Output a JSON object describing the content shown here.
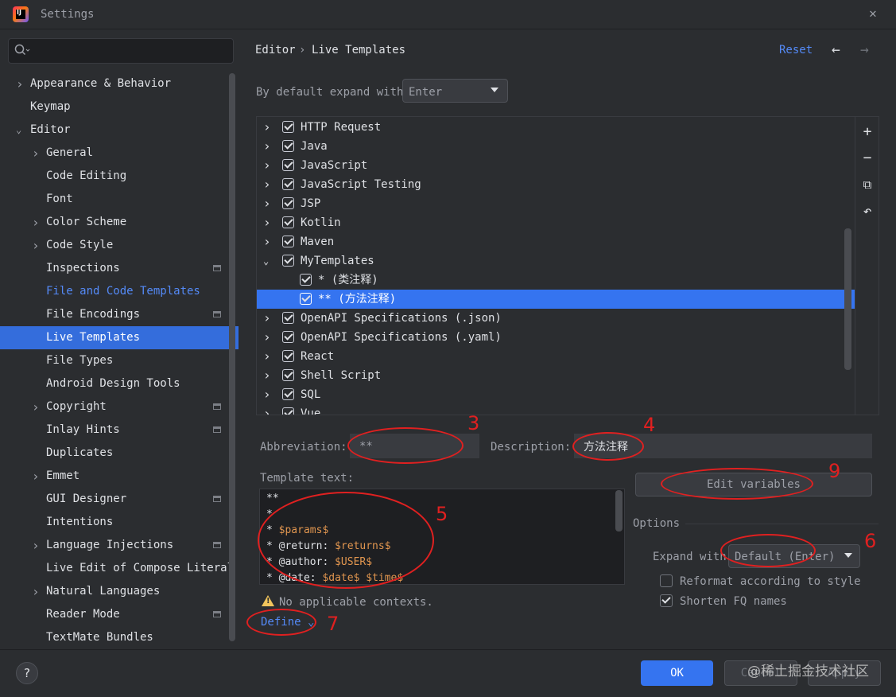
{
  "window": {
    "title": "Settings",
    "logo_text": "IJ"
  },
  "sidebar": {
    "search_placeholder": "",
    "items": [
      {
        "label": "Appearance & Behavior",
        "level": 0,
        "chevron": "collapsed"
      },
      {
        "label": "Keymap",
        "level": 0,
        "chevron": "none"
      },
      {
        "label": "Editor",
        "level": 0,
        "chevron": "expanded"
      },
      {
        "label": "General",
        "level": 1,
        "chevron": "collapsed"
      },
      {
        "label": "Code Editing",
        "level": 1,
        "chevron": "none"
      },
      {
        "label": "Font",
        "level": 1,
        "chevron": "none"
      },
      {
        "label": "Color Scheme",
        "level": 1,
        "chevron": "collapsed"
      },
      {
        "label": "Code Style",
        "level": 1,
        "chevron": "collapsed"
      },
      {
        "label": "Inspections",
        "level": 1,
        "chevron": "none",
        "modified": true
      },
      {
        "label": "File and Code Templates",
        "level": 1,
        "chevron": "none",
        "link": true
      },
      {
        "label": "File Encodings",
        "level": 1,
        "chevron": "none",
        "modified": true
      },
      {
        "label": "Live Templates",
        "level": 1,
        "chevron": "none",
        "selected": true
      },
      {
        "label": "File Types",
        "level": 1,
        "chevron": "none"
      },
      {
        "label": "Android Design Tools",
        "level": 1,
        "chevron": "none"
      },
      {
        "label": "Copyright",
        "level": 1,
        "chevron": "collapsed",
        "modified": true
      },
      {
        "label": "Inlay Hints",
        "level": 1,
        "chevron": "none",
        "modified": true
      },
      {
        "label": "Duplicates",
        "level": 1,
        "chevron": "none"
      },
      {
        "label": "Emmet",
        "level": 1,
        "chevron": "collapsed"
      },
      {
        "label": "GUI Designer",
        "level": 1,
        "chevron": "none",
        "modified": true
      },
      {
        "label": "Intentions",
        "level": 1,
        "chevron": "none"
      },
      {
        "label": "Language Injections",
        "level": 1,
        "chevron": "collapsed",
        "modified": true
      },
      {
        "label": "Live Edit of Compose Literal",
        "level": 1,
        "chevron": "none"
      },
      {
        "label": "Natural Languages",
        "level": 1,
        "chevron": "collapsed"
      },
      {
        "label": "Reader Mode",
        "level": 1,
        "chevron": "none",
        "modified": true
      },
      {
        "label": "TextMate Bundles",
        "level": 1,
        "chevron": "none"
      }
    ]
  },
  "header": {
    "breadcrumb": [
      "Editor",
      "›",
      "Live Templates"
    ],
    "reset_label": "Reset",
    "back_icon": "←",
    "forward_icon": "→"
  },
  "expand_default": {
    "label": "By default expand with",
    "value": "Enter"
  },
  "template_groups": [
    {
      "label": "HTTP Request",
      "checked": true,
      "expanded": false,
      "indent": 0
    },
    {
      "label": "Java",
      "checked": true,
      "expanded": false,
      "indent": 0
    },
    {
      "label": "JavaScript",
      "checked": true,
      "expanded": false,
      "indent": 0
    },
    {
      "label": "JavaScript Testing",
      "checked": true,
      "expanded": false,
      "indent": 0
    },
    {
      "label": "JSP",
      "checked": true,
      "expanded": false,
      "indent": 0
    },
    {
      "label": "Kotlin",
      "checked": true,
      "expanded": false,
      "indent": 0
    },
    {
      "label": "Maven",
      "checked": true,
      "expanded": false,
      "indent": 0
    },
    {
      "label": "MyTemplates",
      "checked": true,
      "expanded": true,
      "indent": 0
    },
    {
      "label": "* (类注释)",
      "checked": true,
      "indent": 1
    },
    {
      "label": "** (方法注释)",
      "checked": true,
      "indent": 1,
      "selected": true
    },
    {
      "label": "OpenAPI Specifications (.json)",
      "checked": true,
      "expanded": false,
      "indent": 0
    },
    {
      "label": "OpenAPI Specifications (.yaml)",
      "checked": true,
      "expanded": false,
      "indent": 0
    },
    {
      "label": "React",
      "checked": true,
      "expanded": false,
      "indent": 0
    },
    {
      "label": "Shell Script",
      "checked": true,
      "expanded": false,
      "indent": 0
    },
    {
      "label": "SQL",
      "checked": true,
      "expanded": false,
      "indent": 0
    },
    {
      "label": "Vue",
      "checked": true,
      "expanded": false,
      "indent": 0
    }
  ],
  "list_toolbar": {
    "add_icon": "+",
    "remove_icon": "−",
    "copy_icon": "⧉",
    "restore_icon": "↶"
  },
  "form": {
    "abbreviation_label": "Abbreviation:",
    "abbreviation_value": "**",
    "description_label": "Description:",
    "description_value": "方法注释",
    "template_text_label": "Template text:",
    "template_lines": [
      [
        {
          "t": "**"
        }
      ],
      [
        {
          "t": "*"
        }
      ],
      [
        {
          "t": "* "
        },
        {
          "t": "$params$",
          "v": true
        }
      ],
      [
        {
          "t": "* @return: "
        },
        {
          "t": "$returns$",
          "v": true
        }
      ],
      [
        {
          "t": "* @author: "
        },
        {
          "t": "$USER$",
          "v": true
        }
      ],
      [
        {
          "t": "* @date: "
        },
        {
          "t": "$date$",
          "v": true
        },
        {
          "t": " "
        },
        {
          "t": "$time$",
          "v": true
        }
      ]
    ],
    "edit_variables_label": "Edit variables",
    "warning_text": "No applicable contexts.",
    "define_label": "Define",
    "define_chevron": "⌄"
  },
  "options": {
    "title": "Options",
    "expand_with_label": "Expand with",
    "expand_with_value": "Default (Enter)",
    "reformat_label": "Reformat according to style",
    "reformat_checked": false,
    "shorten_label": "Shorten FQ names",
    "shorten_checked": true
  },
  "footer": {
    "help_label": "?",
    "ok_label": "OK",
    "cancel_label": "Cancel",
    "apply_label": "Apply",
    "watermark": "@稀土掘金技术社区"
  },
  "annotations": [
    "3",
    "4",
    "5",
    "6",
    "7",
    "9"
  ],
  "colors": {
    "accent": "#3574f0",
    "link": "#548af7",
    "annotation": "#e02020",
    "variable": "#e0954f",
    "background": "#2b2d30"
  }
}
